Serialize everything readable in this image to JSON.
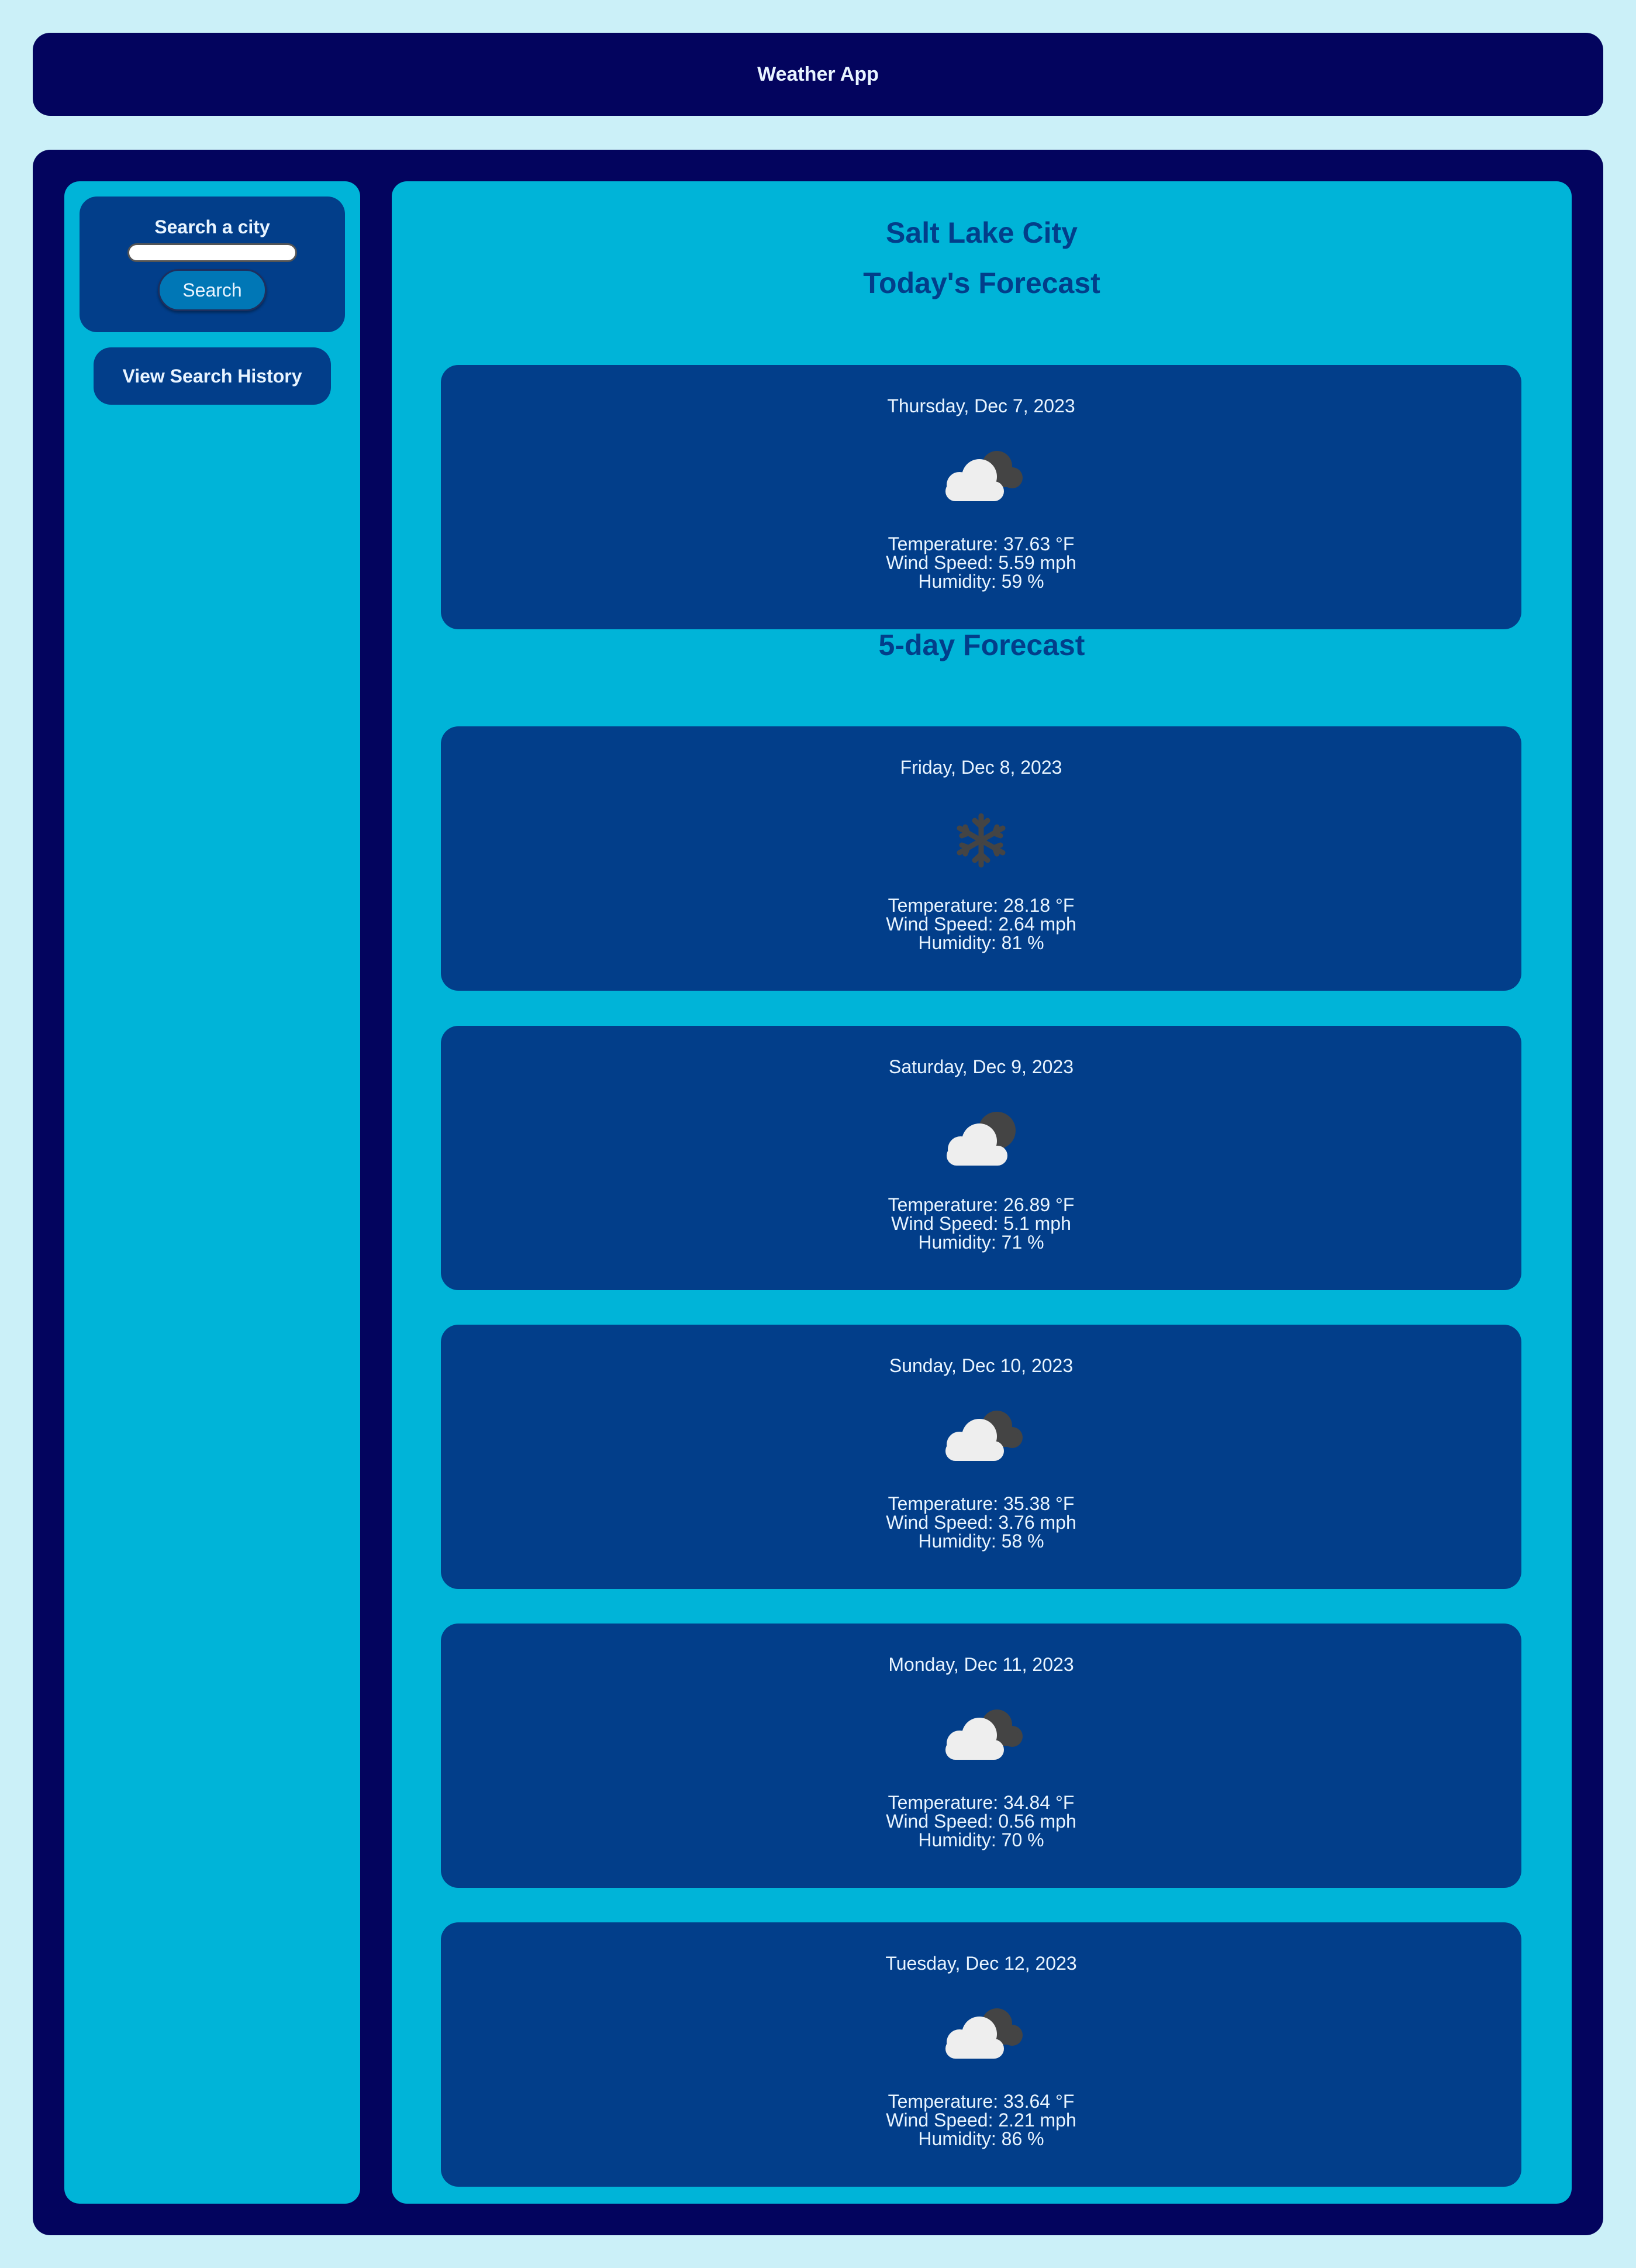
{
  "header": {
    "title": "Weather App"
  },
  "sidebar": {
    "search_label": "Search a city",
    "search_value": "",
    "search_button": "Search",
    "history_button": "View Search History"
  },
  "main": {
    "city": "Salt Lake City",
    "today_title": "Today's Forecast",
    "five_day_title": "5-day Forecast",
    "today": {
      "date": "Thursday, Dec 7, 2023",
      "icon": "partly-cloudy-night-icon",
      "temperature": "Temperature: 37.63 °F",
      "wind": "Wind Speed: 5.59 mph",
      "humidity": "Humidity: 59 %"
    },
    "forecast": [
      {
        "date": "Friday, Dec 8, 2023",
        "icon": "snowflake-icon",
        "temperature": "Temperature: 28.18 °F",
        "wind": "Wind Speed: 2.64 mph",
        "humidity": "Humidity: 81 %"
      },
      {
        "date": "Saturday, Dec 9, 2023",
        "icon": "cloud-moon-icon",
        "temperature": "Temperature: 26.89 °F",
        "wind": "Wind Speed: 5.1 mph",
        "humidity": "Humidity: 71 %"
      },
      {
        "date": "Sunday, Dec 10, 2023",
        "icon": "partly-cloudy-night-icon",
        "temperature": "Temperature: 35.38 °F",
        "wind": "Wind Speed: 3.76 mph",
        "humidity": "Humidity: 58 %"
      },
      {
        "date": "Monday, Dec 11, 2023",
        "icon": "partly-cloudy-night-icon",
        "temperature": "Temperature: 34.84 °F",
        "wind": "Wind Speed: 0.56 mph",
        "humidity": "Humidity: 70 %"
      },
      {
        "date": "Tuesday, Dec 12, 2023",
        "icon": "partly-cloudy-night-icon",
        "temperature": "Temperature: 33.64 °F",
        "wind": "Wind Speed: 2.21 mph",
        "humidity": "Humidity: 86 %"
      }
    ]
  },
  "colors": {
    "page_bg": "#cbf0f8",
    "navy": "#03045e",
    "panel": "#00b4d8",
    "card": "#023e8a",
    "button": "#0077b6",
    "text_light": "#e8f4ff"
  }
}
